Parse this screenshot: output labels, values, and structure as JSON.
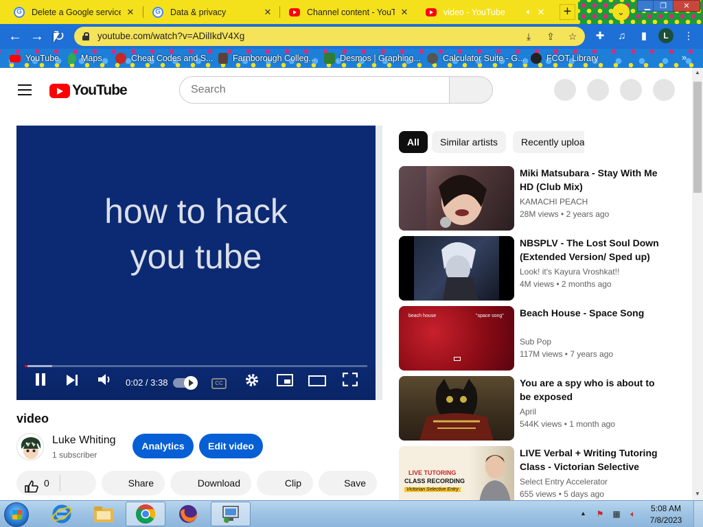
{
  "browser": {
    "tabs": [
      {
        "title": "Delete a Google service",
        "favicon": "google-icon"
      },
      {
        "title": "Data & privacy",
        "favicon": "google-icon"
      },
      {
        "title": "Channel content - YouTube Studio",
        "favicon": "youtube-icon"
      },
      {
        "title": "video - YouTube",
        "favicon": "youtube-icon",
        "active": true,
        "audio": true
      }
    ],
    "new_tab_label": "+",
    "url": "youtube.com/watch?v=ADilIkdV4Xg",
    "profile_initial": "L",
    "bookmarks": [
      {
        "label": "YouTube",
        "icon": "youtube-icon",
        "color": "#ff0000"
      },
      {
        "label": "Maps",
        "icon": "maps-icon",
        "color": "#34a853"
      },
      {
        "label": "Cheat Codes and S...",
        "icon": "site-icon",
        "color": "#c62828"
      },
      {
        "label": "Farnborough Colleg...",
        "icon": "college-icon",
        "color": "#5d4037"
      },
      {
        "label": "Desmos | Graphing...",
        "icon": "desmos-icon",
        "color": "#2e7d32"
      },
      {
        "label": "Calculator Suite - G...",
        "icon": "geogebra-icon",
        "color": "#555555"
      },
      {
        "label": "FCOT Library",
        "icon": "library-icon",
        "color": "#222222"
      }
    ],
    "bookmarks_overflow": "»"
  },
  "youtube": {
    "logo_text": "YouTube",
    "search_placeholder": "Search",
    "player": {
      "on_screen_text_line1": "how to hack",
      "on_screen_text_line2": "you tube",
      "time": "0:02 / 3:38",
      "progress_fraction": 0.009,
      "buffered_fraction": 0.08,
      "cc_label": "CC"
    },
    "video_title": "video",
    "channel": {
      "name": "Luke Whiting",
      "subscribers": "1 subscriber"
    },
    "buttons": {
      "analytics": "Analytics",
      "edit_video": "Edit video",
      "like_count": "0",
      "share": "Share",
      "download": "Download",
      "clip": "Clip",
      "save": "Save"
    },
    "chips": [
      "All",
      "Similar artists",
      "Recently uploaded"
    ],
    "recommendations": [
      {
        "title": "Miki Matsubara - Stay With Me HD (Club Mix)",
        "channel": "KAMACHI PEACH",
        "views": "28M views",
        "age": "2 years ago",
        "thumb_color": "#6b4a48"
      },
      {
        "title": "NBSPLV - The Lost Soul Down (Extended Version/ Sped up)",
        "channel": "Look! it's Kayura Vroshkat!!",
        "views": "4M views",
        "age": "2 months ago",
        "thumb_color": "#2a3650"
      },
      {
        "title": "Beach House - Space Song",
        "channel": "Sub Pop",
        "views": "117M views",
        "age": "7 years ago",
        "thumb_color": "#a0101c",
        "thumb_text_left": "beach house",
        "thumb_text_right": "\"space song\""
      },
      {
        "title": "You are a spy who is about to be exposed",
        "channel": "April",
        "views": "544K views",
        "age": "1 month ago",
        "thumb_color": "#3a2e1e"
      },
      {
        "title": "LIVE Verbal + Writing Tutoring Class - Victorian Selective Entr...",
        "channel": "Select Entry Accelerator",
        "views": "655 views",
        "age": "5 days ago",
        "thumb_color": "#f0e6d0",
        "thumb_text_1": "LIVE TUTORING",
        "thumb_text_2": "CLASS RECORDING",
        "thumb_text_3": "Victorian Selective Entry"
      }
    ]
  },
  "taskbar": {
    "clock_time": "5:08 AM",
    "clock_date": "7/8/2023"
  }
}
